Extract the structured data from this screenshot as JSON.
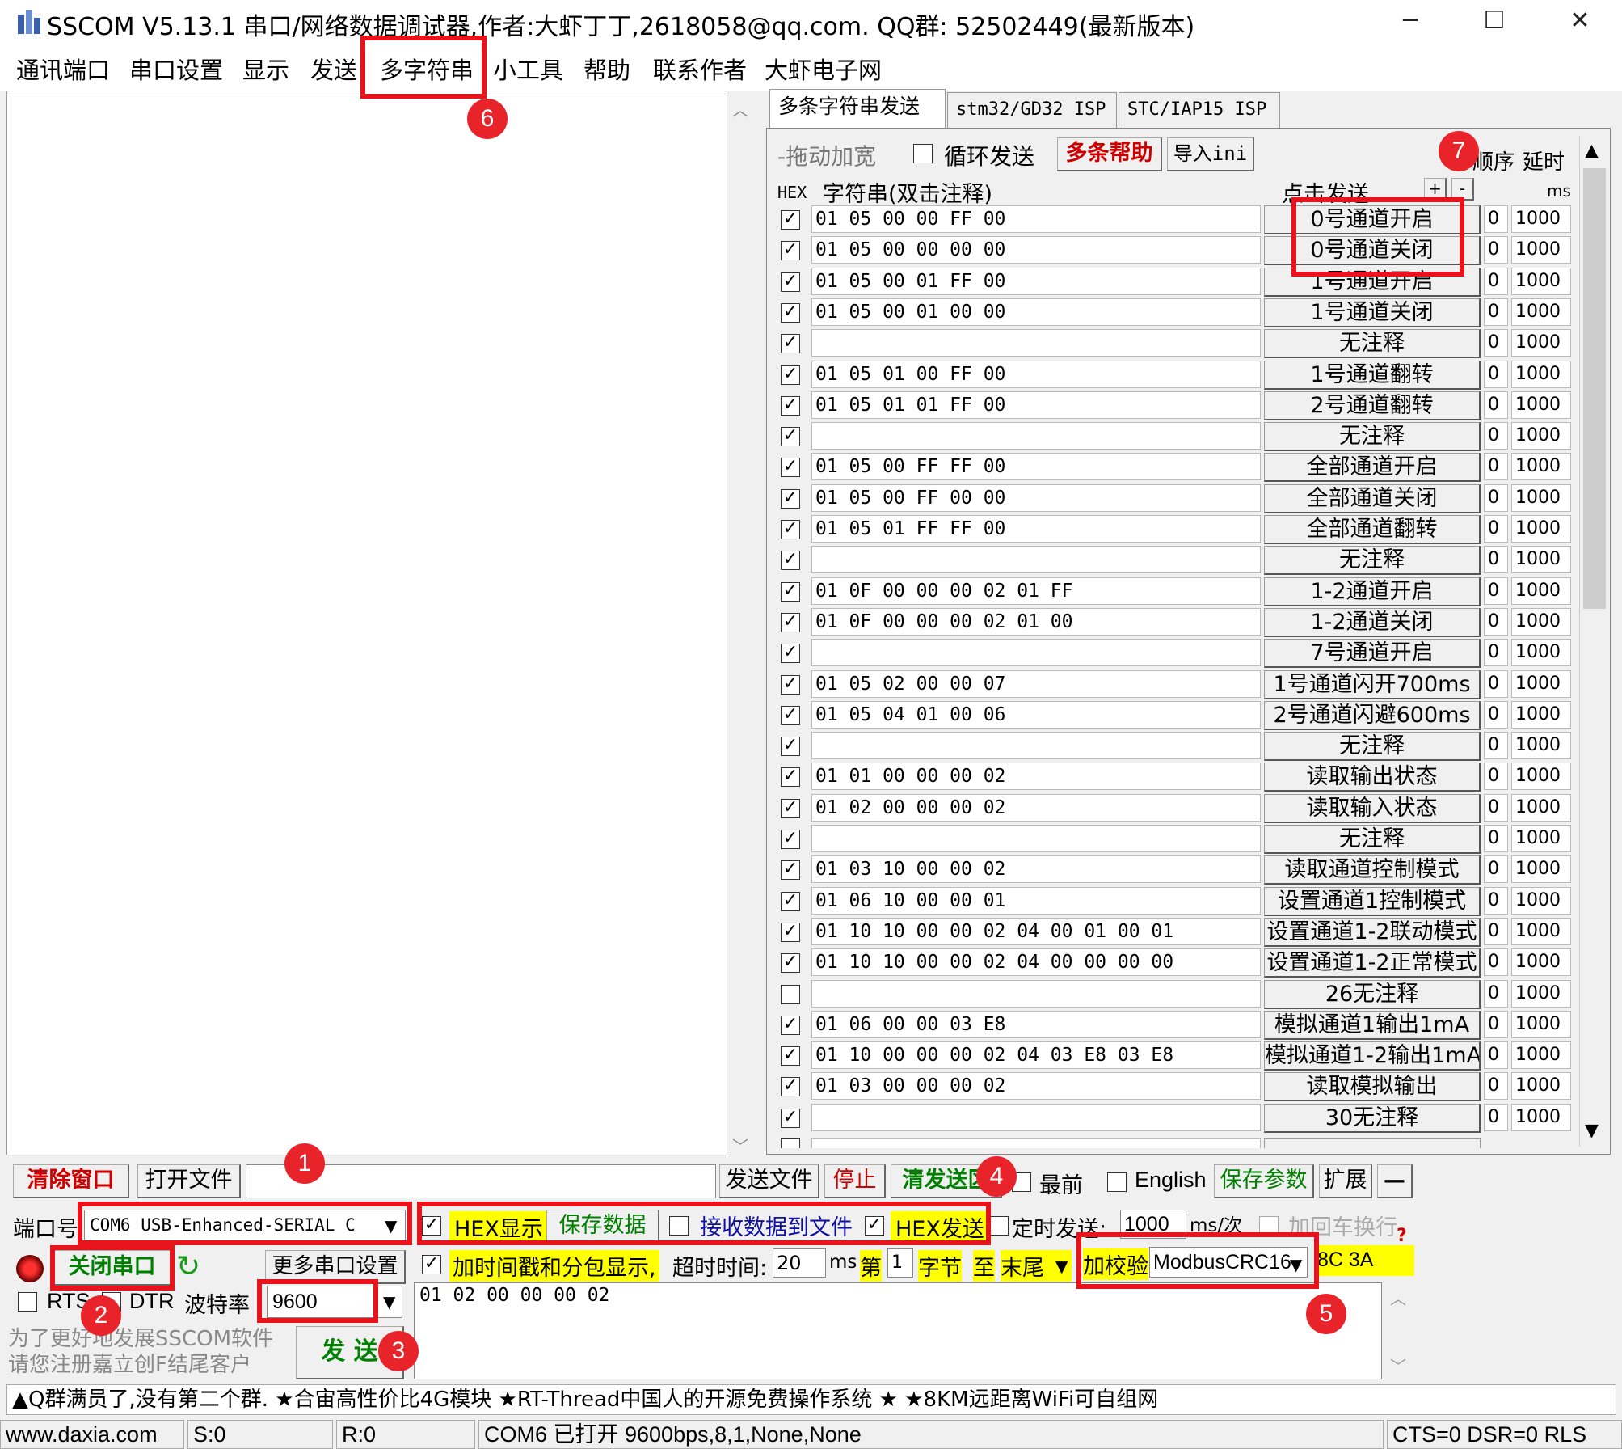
{
  "window": {
    "title": "SSCOM V5.13.1 串口/网络数据调试器,作者:大虾丁丁,2618058@qq.com. QQ群: 52502449(最新版本)",
    "minimize": "─",
    "maximize": "☐",
    "close": "✕"
  },
  "menu": [
    "通讯端口",
    "串口设置",
    "显示",
    "发送",
    "多字符串",
    "小工具",
    "帮助",
    "联系作者",
    "大虾电子网"
  ],
  "tabs": [
    "多条字符串发送",
    "stm32/GD32 ISP",
    "STC/IAP15 ISP"
  ],
  "multi": {
    "drag_label": "-拖动加宽",
    "loop_label": "循环发送",
    "help_btn": "多条帮助",
    "import_btn": "导入ini",
    "order_hdr": "顺序",
    "delay_hdr": "延时",
    "hex_hdr": "HEX",
    "str_hdr": "字符串(双击注释)",
    "click_hdr": "点击发送",
    "plus": "+",
    "minus": "-",
    "ms_hdr": "ms",
    "rows": [
      {
        "checked": true,
        "hex": "01 05 00 00 FF 00",
        "label": "0号通道开启",
        "order": "0",
        "delay": "1000"
      },
      {
        "checked": true,
        "hex": "01 05 00 00 00 00",
        "label": "0号通道关闭",
        "order": "0",
        "delay": "1000"
      },
      {
        "checked": true,
        "hex": "01 05 00 01 FF 00",
        "label": "1号通道开启",
        "order": "0",
        "delay": "1000"
      },
      {
        "checked": true,
        "hex": "01 05 00 01 00 00",
        "label": "1号通道关闭",
        "order": "0",
        "delay": "1000"
      },
      {
        "checked": true,
        "hex": "",
        "label": "无注释",
        "order": "0",
        "delay": "1000"
      },
      {
        "checked": true,
        "hex": "01 05 01 00 FF 00",
        "label": "1号通道翻转",
        "order": "0",
        "delay": "1000"
      },
      {
        "checked": true,
        "hex": "01 05 01 01 FF 00",
        "label": "2号通道翻转",
        "order": "0",
        "delay": "1000"
      },
      {
        "checked": true,
        "hex": "",
        "label": "无注释",
        "order": "0",
        "delay": "1000"
      },
      {
        "checked": true,
        "hex": "01 05 00 FF FF 00",
        "label": "全部通道开启",
        "order": "0",
        "delay": "1000"
      },
      {
        "checked": true,
        "hex": "01 05 00 FF 00 00",
        "label": "全部通道关闭",
        "order": "0",
        "delay": "1000"
      },
      {
        "checked": true,
        "hex": "01 05 01 FF FF 00",
        "label": "全部通道翻转",
        "order": "0",
        "delay": "1000"
      },
      {
        "checked": true,
        "hex": "",
        "label": "无注释",
        "order": "0",
        "delay": "1000"
      },
      {
        "checked": true,
        "hex": "01 0F 00 00 00 02 01 FF",
        "label": "1-2通道开启",
        "order": "0",
        "delay": "1000"
      },
      {
        "checked": true,
        "hex": "01 0F 00 00 00 02 01 00",
        "label": "1-2通道关闭",
        "order": "0",
        "delay": "1000"
      },
      {
        "checked": true,
        "hex": "",
        "label": "7号通道开启",
        "order": "0",
        "delay": "1000"
      },
      {
        "checked": true,
        "hex": "01 05 02 00 00 07",
        "label": "1号通道闪开700ms",
        "order": "0",
        "delay": "1000"
      },
      {
        "checked": true,
        "hex": "01 05 04 01 00 06",
        "label": "2号通道闪避600ms",
        "order": "0",
        "delay": "1000"
      },
      {
        "checked": true,
        "hex": "",
        "label": "无注释",
        "order": "0",
        "delay": "1000"
      },
      {
        "checked": true,
        "hex": "01 01 00 00 00 02",
        "label": "读取输出状态",
        "order": "0",
        "delay": "1000"
      },
      {
        "checked": true,
        "hex": "01 02 00 00 00 02",
        "label": "读取输入状态",
        "order": "0",
        "delay": "1000"
      },
      {
        "checked": true,
        "hex": "",
        "label": "无注释",
        "order": "0",
        "delay": "1000"
      },
      {
        "checked": true,
        "hex": "01 03 10 00 00 02",
        "label": "读取通道控制模式",
        "order": "0",
        "delay": "1000"
      },
      {
        "checked": true,
        "hex": "01 06 10 00 00 01",
        "label": "设置通道1控制模式",
        "order": "0",
        "delay": "1000"
      },
      {
        "checked": true,
        "hex": "01 10 10 00 00 02 04 00 01 00 01",
        "label": "设置通道1-2联动模式",
        "order": "0",
        "delay": "1000"
      },
      {
        "checked": true,
        "hex": "01 10 10 00 00 02 04 00 00 00 00",
        "label": "设置通道1-2正常模式",
        "order": "0",
        "delay": "1000"
      },
      {
        "checked": false,
        "hex": "",
        "label": "26无注释",
        "order": "0",
        "delay": "1000"
      },
      {
        "checked": true,
        "hex": "01 06 00 00 03 E8",
        "label": "模拟通道1输出1mA",
        "order": "0",
        "delay": "1000"
      },
      {
        "checked": true,
        "hex": "01 10 00 00 00 02 04 03 E8 03 E8",
        "label": "模拟通道1-2输出1mA",
        "order": "0",
        "delay": "1000"
      },
      {
        "checked": true,
        "hex": "01 03 00 00 00 02",
        "label": "读取模拟输出",
        "order": "0",
        "delay": "1000"
      },
      {
        "checked": true,
        "hex": "",
        "label": "30无注释",
        "order": "0",
        "delay": "1000"
      }
    ]
  },
  "toolbar": {
    "clear": "清除窗口",
    "open_file": "打开文件",
    "send_file": "发送文件",
    "stop": "停止",
    "clear_send": "清发送区",
    "topmost": "最前",
    "english": "English",
    "save_params": "保存参数",
    "expand": "扩展",
    "collapse": "—"
  },
  "port": {
    "port_label": "端口号",
    "port_value": "COM6 USB-Enhanced-SERIAL C",
    "close_port": "关闭串口",
    "more_settings": "更多串口设置",
    "rts": "RTS",
    "dtr": "DTR",
    "baud_label": "波特率",
    "baud_value": "9600",
    "promo": "为了更好地发展SSCOM软件\n请您注册嘉立创F结尾客户",
    "send": "发 送"
  },
  "options": {
    "hex_display": "HEX显示",
    "save_data": "保存数据",
    "recv_to_file": "接收数据到文件",
    "hex_send": "HEX发送",
    "timed_send": "定时发送:",
    "period": "1000",
    "period_unit": "ms/次",
    "add_crlf": "加回车换行",
    "timestamp": "加时间戳和分包显示,",
    "timeout_label": "超时时间:",
    "timeout_value": "20",
    "ms": "ms",
    "nth": "第",
    "nth_value": "1",
    "byte": "字节",
    "to": "至",
    "tail": "末尾",
    "checksum_label": "加校验",
    "checksum_value": "ModbusCRC16",
    "checksum_result": "8C 3A",
    "question": "?"
  },
  "send_area": {
    "value": "01 02 00 00 00 02"
  },
  "marquee": "▲Q群满员了,没有第二个群. ★合宙高性价比4G模块 ★RT-Thread中国人的开源免费操作系统 ★ ★8KM远距离WiFi可自组网",
  "status": {
    "site": "www.daxia.com",
    "sent": "S:0",
    "recv": "R:0",
    "port_state": "COM6 已打开  9600bps,8,1,None,None",
    "lines": "CTS=0 DSR=0 RLS"
  },
  "badges": [
    "1",
    "2",
    "3",
    "4",
    "5",
    "6",
    "7"
  ],
  "colors": {
    "highlight": "#e8141b",
    "yellow": "#ffff00",
    "green": "#008000",
    "red": "#d00000"
  }
}
